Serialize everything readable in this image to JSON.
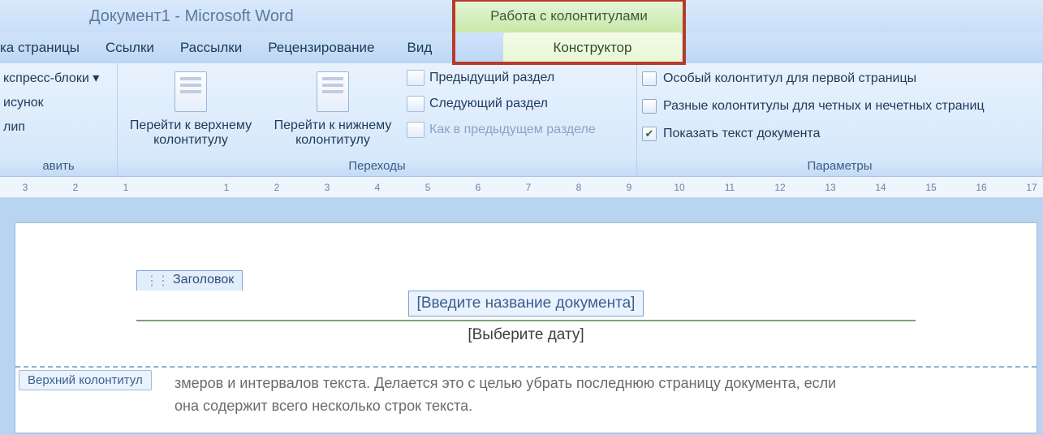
{
  "title": "Документ1 - Microsoft Word",
  "contextTabGroup": "Работа с колонтитулами",
  "tabs": {
    "pageLayout": "ка страницы",
    "references": "Ссылки",
    "mailings": "Рассылки",
    "review": "Рецензирование",
    "view": "Вид",
    "design": "Конструктор"
  },
  "group1": {
    "expressBlocks": "кспресс-блоки ▾",
    "picture": "исунок",
    "clip": "лип",
    "label": "авить"
  },
  "group2": {
    "goHeader": "Перейти к верхнему\nколонтитулу",
    "goFooter": "Перейти к нижнему\nколонтитулу",
    "prevSection": "Предыдущий раздел",
    "nextSection": "Следующий раздел",
    "linkPrev": "Как в предыдущем разделе",
    "label": "Переходы"
  },
  "group3": {
    "diffFirst": "Особый колонтитул для первой страницы",
    "diffOddEven": "Разные колонтитулы для четных и нечетных страниц",
    "showDoc": "Показать текст документа",
    "label": "Параметры"
  },
  "ruler": [
    "3",
    "2",
    "1",
    "",
    "1",
    "2",
    "3",
    "4",
    "5",
    "6",
    "7",
    "8",
    "9",
    "10",
    "11",
    "12",
    "13",
    "14",
    "15",
    "16",
    "17"
  ],
  "doc": {
    "ccTab": "Заголовок",
    "ccPlaceholder": "[Введите название документа]",
    "datePlaceholder": "[Выберите дату]",
    "hfTag": "Верхний колонтитул",
    "bodyLine1": "змеров и интервалов текста. Делается это с целью убрать последнюю страницу документа, если",
    "bodyLine2": "она содержит всего несколько строк текста."
  }
}
